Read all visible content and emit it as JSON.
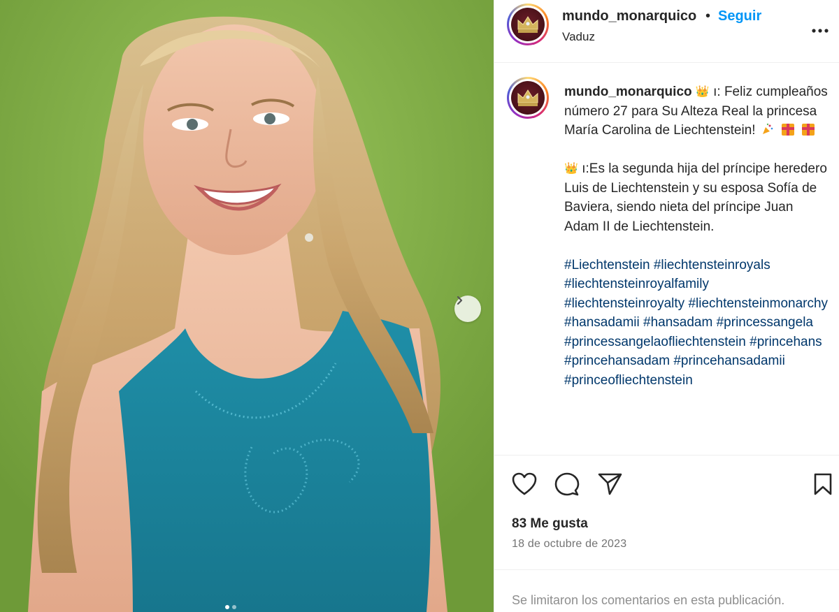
{
  "post": {
    "carousel_dots": 2
  },
  "header": {
    "username": "mundo_monarquico",
    "separator": "•",
    "follow_label": "Seguir",
    "location": "Vaduz",
    "more_icon": "more-horizontal-icon",
    "more_label": "..."
  },
  "caption": {
    "username": "mundo_monarquico",
    "paragraph1": "Feliz cumpleaños número 27 para Su Alteza Real la princesa María Carolina de Liechtenstein!",
    "paragraph2": "Es la segunda hija del príncipe heredero Luis de Liechtenstein y su esposa Sofía de Baviera, siendo nieta del príncipe Juan Adam II de Liechtenstein.",
    "hashtags": [
      "#Liechtenstein",
      "#liechtensteinroyals",
      "#liechtensteinroyalfamily",
      "#liechtensteinroyalty",
      "#liechtensteinmonarchy",
      "#hansadamii",
      "#hansadam",
      "#princessangela",
      "#princessangelaofliechtenstein",
      "#princehans",
      "#princehansadam",
      "#princehansadamii",
      "#princeofliechtenstein"
    ],
    "glyph": "ı:",
    "crown_emoji": "👑"
  },
  "actions": {
    "like_icon": "heart-icon",
    "comment_icon": "comment-icon",
    "share_icon": "send-icon",
    "save_icon": "bookmark-icon"
  },
  "likes": "83 Me gusta",
  "date": "18 de octubre de 2023",
  "comments_limited": "Se limitaron los comentarios en esta publicación.",
  "colors": {
    "follow": "#0095f6",
    "hashtag": "#00376b",
    "muted": "#737373"
  }
}
